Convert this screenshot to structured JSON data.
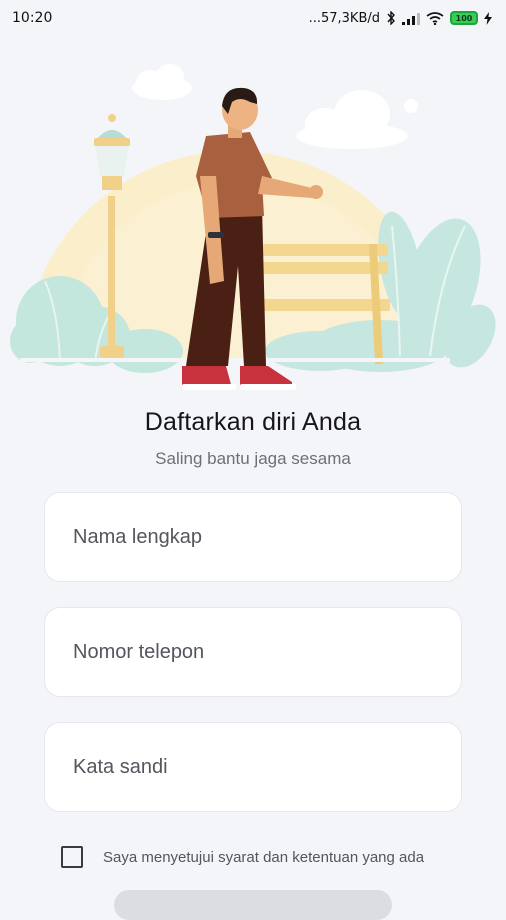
{
  "status_bar": {
    "time": "10:20",
    "network_speed": "...57,3KB/d",
    "battery_level": "100",
    "icons": [
      "bluetooth-icon",
      "signal-icon",
      "wifi-icon",
      "battery-icon",
      "charging-icon"
    ]
  },
  "illustration": {
    "description_icon": "man-with-bench-illustration"
  },
  "header": {
    "title": "Daftarkan diri Anda",
    "subtitle": "Saling bantu jaga sesama"
  },
  "form": {
    "full_name_placeholder": "Nama lengkap",
    "phone_placeholder": "Nomor telepon",
    "password_placeholder": "Kata sandi",
    "agreement_label": "Saya menyetujui syarat dan ketentuan yang ada",
    "agreement_checked": false
  },
  "colors": {
    "background": "#f4f5f9",
    "sun": "#fbedc5",
    "plant": "#bfe3dc",
    "shirt": "#a9603f",
    "pants": "#4a2014",
    "shoes": "#c8323c",
    "bench": "#f3d78f"
  }
}
